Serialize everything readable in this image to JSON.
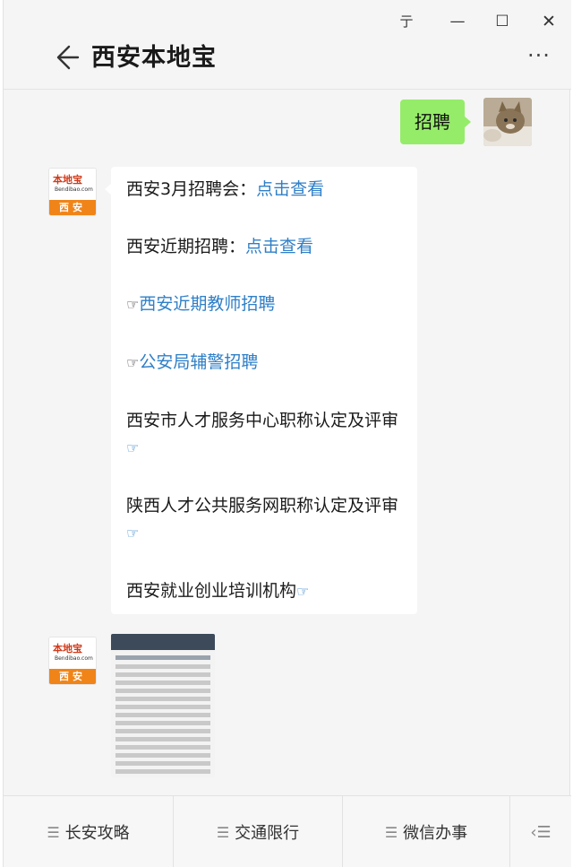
{
  "window": {
    "controls": {
      "pin": "亍",
      "minimize": "—",
      "maximize": "☐",
      "close": "✕"
    }
  },
  "header": {
    "title": "西安本地宝",
    "more": "···"
  },
  "messages": {
    "sent": {
      "text": "招聘"
    },
    "avatar_brand": {
      "logo": "本地宝",
      "domain": "Bendibao.com",
      "city": "西安"
    },
    "lines": [
      {
        "prefix": "西安3月招聘会：",
        "link": "点击查看"
      },
      {
        "prefix": "西安近期招聘：",
        "link": "点击查看"
      },
      {
        "hand": "☞",
        "link": "西安近期教师招聘"
      },
      {
        "hand": "☞",
        "link": "公安局辅警招聘"
      },
      {
        "prefix": "西安市人才服务中心职称认定及评审",
        "suffix_hand": "☞"
      },
      {
        "prefix": "陕西人才公共服务网职称认定及评审",
        "suffix_hand": "☞"
      },
      {
        "prefix": "西安就业创业培训机构",
        "suffix_hand": "☞"
      }
    ]
  },
  "bottom_menu": [
    {
      "label": "长安攻略"
    },
    {
      "label": "交通限行"
    },
    {
      "label": "微信办事"
    }
  ],
  "colors": {
    "accent_link": "#2f7fc7",
    "sent_bubble": "#95ec69",
    "brand_orange": "#f08419"
  }
}
